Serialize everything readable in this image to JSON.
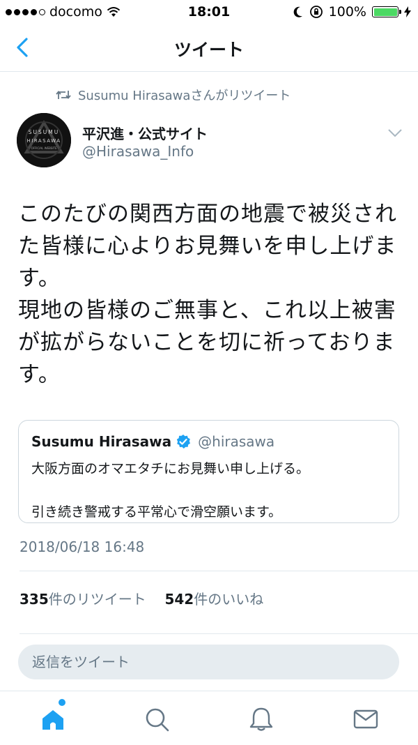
{
  "status_bar": {
    "carrier": "docomo",
    "time": "18:01",
    "battery": "100%"
  },
  "nav": {
    "title": "ツイート"
  },
  "retweet_context": {
    "text": "Susumu Hirasawaさんがリツイート"
  },
  "author": {
    "name": "平沢進・公式サイト",
    "handle": "@Hirasawa_Info",
    "avatar_text_line1": "SUSUMU",
    "avatar_text_line2": "HIRASAWA",
    "avatar_text_line3": "OFFICIAL WEBSITE"
  },
  "tweet": {
    "text": "このたびの関西方面の地震で被災された皆様に心よりお見舞いを申し上げます。\n現地の皆様のご無事と、これ以上被害が拡がらないことを切に祈っております。"
  },
  "quoted": {
    "name": "Susumu Hirasawa",
    "handle": "@hirasawa",
    "text": "大阪方面のオマエタチにお見舞い申し上げる。\n\n引き続き警戒する平常心で滑空願います。"
  },
  "timestamp": "2018/06/18 16:48",
  "stats": {
    "retweet_count": "335",
    "retweet_label": "件のリツイート",
    "like_count": "542",
    "like_label": "件のいいね"
  },
  "reply": {
    "placeholder": "返信をツイート"
  },
  "colors": {
    "accent": "#1da1f2",
    "muted": "#657786",
    "battery_green": "#4cd964"
  },
  "tabbar": {
    "icons": [
      "home-icon",
      "search-icon",
      "notifications-icon",
      "messages-icon"
    ]
  }
}
